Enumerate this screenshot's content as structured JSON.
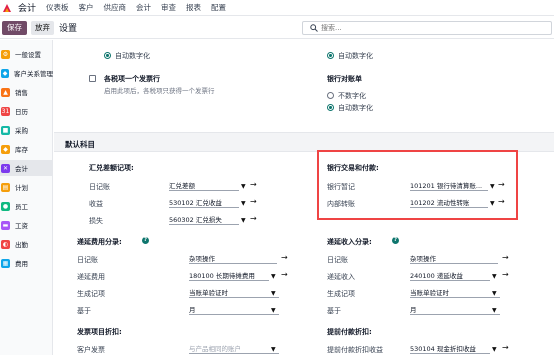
{
  "topbar": {
    "app_name": "会计",
    "menu": [
      "仪表板",
      "客户",
      "供应商",
      "会计",
      "审查",
      "报表",
      "配置"
    ]
  },
  "control": {
    "save_label": "保存",
    "discard_label": "放弃",
    "title": "设置",
    "search_placeholder": "搜索..."
  },
  "sidebar": {
    "items": [
      {
        "label": "一般设置",
        "icon": "gear-icon",
        "color": "#f59e0b"
      },
      {
        "label": "客户关系管理",
        "icon": "crm-icon",
        "color": "#0ea5e9"
      },
      {
        "label": "销售",
        "icon": "sales-icon",
        "color": "#f97316"
      },
      {
        "label": "日历",
        "icon": "calendar-icon",
        "color": "#ef4444"
      },
      {
        "label": "采购",
        "icon": "purchase-icon",
        "color": "#14b8a6"
      },
      {
        "label": "库存",
        "icon": "inventory-icon",
        "color": "#f59e0b"
      },
      {
        "label": "会计",
        "icon": "accounting-icon",
        "color": "#7c3aed"
      },
      {
        "label": "计划",
        "icon": "planning-icon",
        "color": "#f59e0b"
      },
      {
        "label": "员工",
        "icon": "employees-icon",
        "color": "#10b981"
      },
      {
        "label": "工资",
        "icon": "payroll-icon",
        "color": "#a855f7"
      },
      {
        "label": "出勤",
        "icon": "attendance-icon",
        "color": "#ef4444"
      },
      {
        "label": "费用",
        "icon": "expenses-icon",
        "color": "#0ea5e9"
      }
    ]
  },
  "top_section": {
    "left_radio_auto": "自动数字化",
    "right_radio_auto": "自动数字化",
    "checkbox_title": "各税项一个发票行",
    "checkbox_desc": "启用此项后，各税项只获得一个发票行",
    "bank_bill_title": "银行对账单",
    "radio_no_digit": "不数字化",
    "radio_auto_digit": "自动数字化"
  },
  "default_accounts": {
    "section_title": "默认科目",
    "fx": {
      "title": "汇兑差额记项:",
      "rows": [
        {
          "label": "日记账",
          "value": "汇兑差额"
        },
        {
          "label": "收益",
          "value": "530102 汇兑收益"
        },
        {
          "label": "损失",
          "value": "560302 汇兑损失"
        }
      ]
    },
    "bank": {
      "title": "银行交易和付款:",
      "rows": [
        {
          "label": "银行暂记",
          "value": "101201 银行待清算账..."
        },
        {
          "label": "内部转账",
          "value": "101202 流动性转账"
        }
      ]
    },
    "deferred_expense": {
      "title": "递延费用分录:",
      "rows": [
        {
          "label": "日记账",
          "value": "杂项操作"
        },
        {
          "label": "递延费用",
          "value": "180100 长期待摊费用"
        },
        {
          "label": "生成记项",
          "value": "当账单验证时"
        },
        {
          "label": "基于",
          "value": "月"
        }
      ]
    },
    "deferred_revenue": {
      "title": "递延收入分录:",
      "rows": [
        {
          "label": "日记账",
          "value": "杂项操作"
        },
        {
          "label": "递延收入",
          "value": "240100 递延收益"
        },
        {
          "label": "生成记项",
          "value": "当账单验证时"
        },
        {
          "label": "基于",
          "value": "月"
        }
      ]
    },
    "invoice_discount": {
      "title": "发票项目折扣:",
      "row_label": "客户发票",
      "row_placeholder": "与产品相同的账户"
    },
    "early_payment": {
      "title": "提前付款折扣:",
      "row_label": "提前付款折扣收益",
      "row_value": "530104 现金折扣收益"
    }
  }
}
